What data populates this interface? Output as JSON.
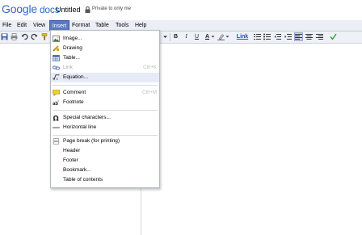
{
  "header": {
    "logo_google": "Google",
    "logo_docs": "docs",
    "doc_title": "Untitled",
    "privacy": "Private to only me"
  },
  "menubar": {
    "items": [
      "File",
      "Edit",
      "View",
      "Insert",
      "Format",
      "Table",
      "Tools",
      "Help"
    ]
  },
  "toolbar": {
    "bold": "B",
    "italic": "I",
    "underline": "U",
    "text_color": "A",
    "link": "Link"
  },
  "insert_menu": {
    "items": [
      {
        "label": "Image...",
        "icon": "image-icon"
      },
      {
        "label": "Drawing",
        "icon": "drawing-icon"
      },
      {
        "label": "Table...",
        "icon": "table-icon"
      },
      {
        "label": "Link",
        "icon": "link-icon",
        "shortcut": "Ctrl+K",
        "disabled": true
      },
      {
        "label": "Equation...",
        "icon": "equation-icon",
        "highlighted": true
      },
      {
        "label": "Comment",
        "icon": "comment-icon",
        "shortcut": "Ctrl+M"
      },
      {
        "label": "Footnote",
        "icon": "footnote-icon"
      },
      {
        "label": "Special characters...",
        "icon": "omega-icon"
      },
      {
        "label": "Horizontal line",
        "icon": "horizontal-line-icon"
      },
      {
        "label": "Page break (for printing)",
        "icon": "page-break-icon"
      },
      {
        "label": "Header"
      },
      {
        "label": "Footer"
      },
      {
        "label": "Bookmark..."
      },
      {
        "label": "Table of contents"
      }
    ]
  },
  "colors": {
    "menu_active": "#5b78c1",
    "menubar_bg": "#eceef5",
    "highlight_row": "#e6ebf7",
    "link_blue": "#1a4fb3"
  }
}
